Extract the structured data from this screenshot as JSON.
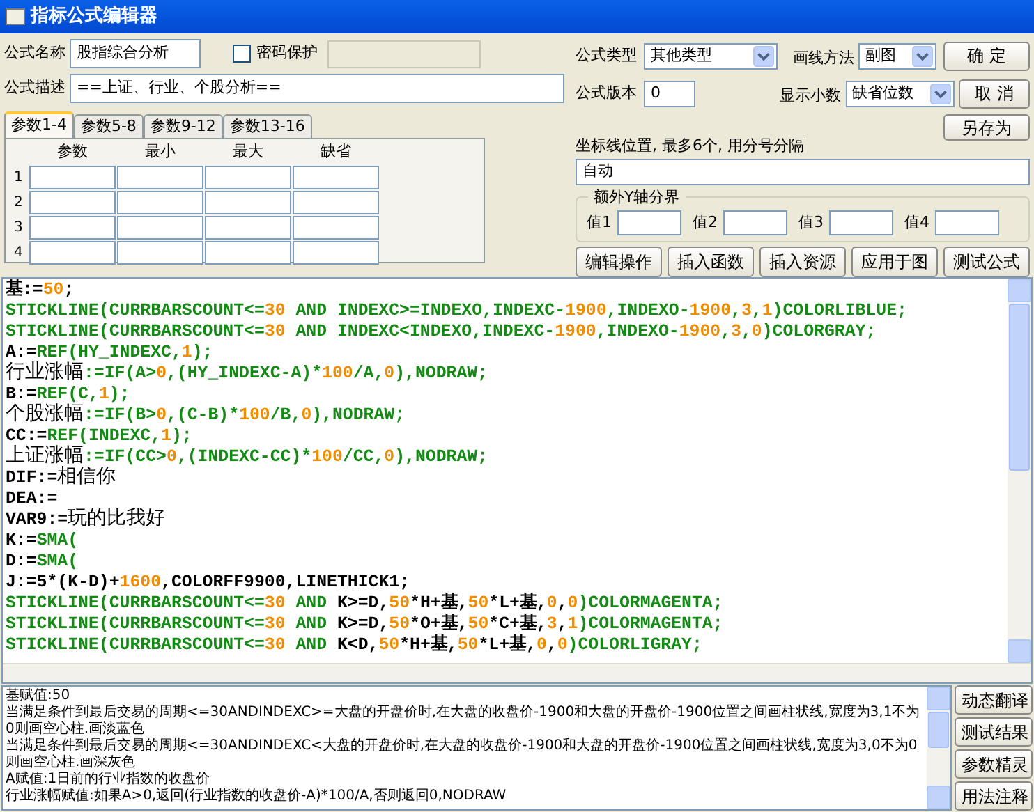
{
  "window": {
    "title": "指标公式编辑器"
  },
  "form": {
    "name_label": "公式名称",
    "name_value": "股指综合分析",
    "password": {
      "label": "密码保护",
      "checked": false
    },
    "type_label": "公式类型",
    "type_value": "其他类型",
    "draw_label": "画线方法",
    "draw_value": "副图",
    "ok": "确  定",
    "desc_label": "公式描述",
    "desc_value": "==上证、行业、个股分析==",
    "version_label": "公式版本",
    "version_value": "0",
    "decimals_label": "显示小数",
    "decimals_value": "缺省位数",
    "cancel": "取  消",
    "save_as": "另存为"
  },
  "param_tabs": [
    {
      "label": "参数1-4",
      "selected": true
    },
    {
      "label": "参数5-8",
      "selected": false
    },
    {
      "label": "参数9-12",
      "selected": false
    },
    {
      "label": "参数13-16",
      "selected": false
    }
  ],
  "param_columns": [
    "参数",
    "最小",
    "最大",
    "缺省"
  ],
  "param_rows": [
    "1",
    "2",
    "3",
    "4"
  ],
  "axis": {
    "label": "坐标线位置, 最多6个, 用分号分隔",
    "value": "自动",
    "group": "额外Y轴分界",
    "values": [
      "值1",
      "值2",
      "值3",
      "值4"
    ]
  },
  "actions": [
    "编辑操作",
    "插入函数",
    "插入资源",
    "应用于图",
    "测试公式"
  ],
  "code": [
    [
      {
        "text": "基:=",
        "kind": "name"
      },
      {
        "text": "50",
        "kind": "number"
      },
      {
        "text": ";",
        "kind": "name"
      }
    ],
    [
      {
        "text": "STICKLINE(CURRBARSCOUNT<=",
        "kind": "function"
      },
      {
        "text": "30",
        "kind": "number"
      },
      {
        "text": " AND INDEXC>=INDEXO,INDEXC-",
        "kind": "function"
      },
      {
        "text": "1900",
        "kind": "number"
      },
      {
        "text": ",INDEXO-",
        "kind": "function"
      },
      {
        "text": "1900",
        "kind": "number"
      },
      {
        "text": ",",
        "kind": "function"
      },
      {
        "text": "3",
        "kind": "number"
      },
      {
        "text": ",",
        "kind": "function"
      },
      {
        "text": "1",
        "kind": "number"
      },
      {
        "text": ")COLORLIBLUE;",
        "kind": "function"
      }
    ],
    [
      {
        "text": "STICKLINE(CURRBARSCOUNT<=",
        "kind": "function"
      },
      {
        "text": "30",
        "kind": "number"
      },
      {
        "text": " AND INDEXC<INDEXO,INDEXC-",
        "kind": "function"
      },
      {
        "text": "1900",
        "kind": "number"
      },
      {
        "text": ",INDEXO-",
        "kind": "function"
      },
      {
        "text": "1900",
        "kind": "number"
      },
      {
        "text": ",",
        "kind": "function"
      },
      {
        "text": "3",
        "kind": "number"
      },
      {
        "text": ",",
        "kind": "function"
      },
      {
        "text": "0",
        "kind": "number"
      },
      {
        "text": ")COLORGRAY;",
        "kind": "function"
      }
    ],
    [
      {
        "text": "A:=",
        "kind": "name"
      },
      {
        "text": "REF(HY_INDEXC,",
        "kind": "function"
      },
      {
        "text": "1",
        "kind": "number"
      },
      {
        "text": ");",
        "kind": "function"
      }
    ],
    [
      {
        "text": "行业涨幅",
        "kind": "chinese"
      },
      {
        "text": ":=IF(A>",
        "kind": "function"
      },
      {
        "text": "0",
        "kind": "number"
      },
      {
        "text": ",(HY_INDEXC-A)*",
        "kind": "function"
      },
      {
        "text": "100",
        "kind": "number"
      },
      {
        "text": "/A,",
        "kind": "function"
      },
      {
        "text": "0",
        "kind": "number"
      },
      {
        "text": "),NODRAW;",
        "kind": "function"
      }
    ],
    [
      {
        "text": "B:=",
        "kind": "name"
      },
      {
        "text": "REF(C,",
        "kind": "function"
      },
      {
        "text": "1",
        "kind": "number"
      },
      {
        "text": ");",
        "kind": "function"
      }
    ],
    [
      {
        "text": "个股涨幅",
        "kind": "chinese"
      },
      {
        "text": ":=IF(B>",
        "kind": "function"
      },
      {
        "text": "0",
        "kind": "number"
      },
      {
        "text": ",(C-B)*",
        "kind": "function"
      },
      {
        "text": "100",
        "kind": "number"
      },
      {
        "text": "/B,",
        "kind": "function"
      },
      {
        "text": "0",
        "kind": "number"
      },
      {
        "text": "),NODRAW;",
        "kind": "function"
      }
    ],
    [
      {
        "text": "CC:=",
        "kind": "name"
      },
      {
        "text": "REF(INDEXC,",
        "kind": "function"
      },
      {
        "text": "1",
        "kind": "number"
      },
      {
        "text": ");",
        "kind": "function"
      }
    ],
    [
      {
        "text": "上证涨幅",
        "kind": "chinese"
      },
      {
        "text": ":=IF(CC>",
        "kind": "function"
      },
      {
        "text": "0",
        "kind": "number"
      },
      {
        "text": ",(INDEXC-CC)*",
        "kind": "function"
      },
      {
        "text": "100",
        "kind": "number"
      },
      {
        "text": "/CC,",
        "kind": "function"
      },
      {
        "text": "0",
        "kind": "number"
      },
      {
        "text": "),NODRAW;",
        "kind": "function"
      }
    ],
    [
      {
        "text": "DIF:=",
        "kind": "name"
      },
      {
        "text": "相信你",
        "kind": "chinese"
      }
    ],
    [
      {
        "text": "DEA:=",
        "kind": "name"
      }
    ],
    [
      {
        "text": "VAR9:=",
        "kind": "name"
      },
      {
        "text": "玩的比我好",
        "kind": "chinese"
      }
    ],
    [
      {
        "text": "K:=",
        "kind": "name"
      },
      {
        "text": "SMA(",
        "kind": "function"
      }
    ],
    [
      {
        "text": "D:=",
        "kind": "name"
      },
      {
        "text": "SMA(",
        "kind": "function"
      }
    ],
    [
      {
        "text": "J:=5*(K-D)+",
        "kind": "name"
      },
      {
        "text": "1600",
        "kind": "number"
      },
      {
        "text": ",COLORFF9900,LINETHICK1;",
        "kind": "name"
      }
    ],
    [
      {
        "text": "STICKLINE(CURRBARSCOUNT<=",
        "kind": "function"
      },
      {
        "text": "30",
        "kind": "number"
      },
      {
        "text": " AND ",
        "kind": "function"
      },
      {
        "text": "K>=D,",
        "kind": "name"
      },
      {
        "text": "50",
        "kind": "number"
      },
      {
        "text": "*H+基,",
        "kind": "name"
      },
      {
        "text": "50",
        "kind": "number"
      },
      {
        "text": "*L+基,",
        "kind": "name"
      },
      {
        "text": "0",
        "kind": "number"
      },
      {
        "text": ",",
        "kind": "name"
      },
      {
        "text": "0",
        "kind": "number"
      },
      {
        "text": ")COLORMAGENTA;",
        "kind": "function"
      }
    ],
    [
      {
        "text": "STICKLINE(CURRBARSCOUNT<=",
        "kind": "function"
      },
      {
        "text": "30",
        "kind": "number"
      },
      {
        "text": " AND ",
        "kind": "function"
      },
      {
        "text": "K>=D,",
        "kind": "name"
      },
      {
        "text": "50",
        "kind": "number"
      },
      {
        "text": "*O+基,",
        "kind": "name"
      },
      {
        "text": "50",
        "kind": "number"
      },
      {
        "text": "*C+基,",
        "kind": "name"
      },
      {
        "text": "3",
        "kind": "number"
      },
      {
        "text": ",",
        "kind": "name"
      },
      {
        "text": "1",
        "kind": "number"
      },
      {
        "text": ")COLORMAGENTA;",
        "kind": "function"
      }
    ],
    [
      {
        "text": "STICKLINE(CURRBARSCOUNT<=",
        "kind": "function"
      },
      {
        "text": "30",
        "kind": "number"
      },
      {
        "text": " AND ",
        "kind": "function"
      },
      {
        "text": "K<D,",
        "kind": "name"
      },
      {
        "text": "50",
        "kind": "number"
      },
      {
        "text": "*H+基,",
        "kind": "name"
      },
      {
        "text": "50",
        "kind": "number"
      },
      {
        "text": "*L+基,",
        "kind": "name"
      },
      {
        "text": "0",
        "kind": "number"
      },
      {
        "text": ",",
        "kind": "name"
      },
      {
        "text": "0",
        "kind": "number"
      },
      {
        "text": ")COLORLIGRAY;",
        "kind": "function"
      }
    ]
  ],
  "translation": [
    "基赋值:50",
    "当满足条件到最后交易的周期<=30ANDINDEXC>=大盘的开盘价时,在大盘的收盘价-1900和大盘的开盘价-1900位置之间画柱状线,宽度为3,1不为0则画空心柱.画淡蓝色",
    "当满足条件到最后交易的周期<=30ANDINDEXC<大盘的开盘价时,在大盘的收盘价-1900和大盘的开盘价-1900位置之间画柱状线,宽度为3,0不为0则画空心柱.画深灰色",
    "A赋值:1日前的行业指数的收盘价",
    "行业涨幅赋值:如果A>0,返回(行业指数的收盘价-A)*100/A,否则返回0,NODRAW"
  ],
  "side_buttons": [
    "动态翻译",
    "测试结果",
    "参数精灵",
    "用法注释"
  ]
}
